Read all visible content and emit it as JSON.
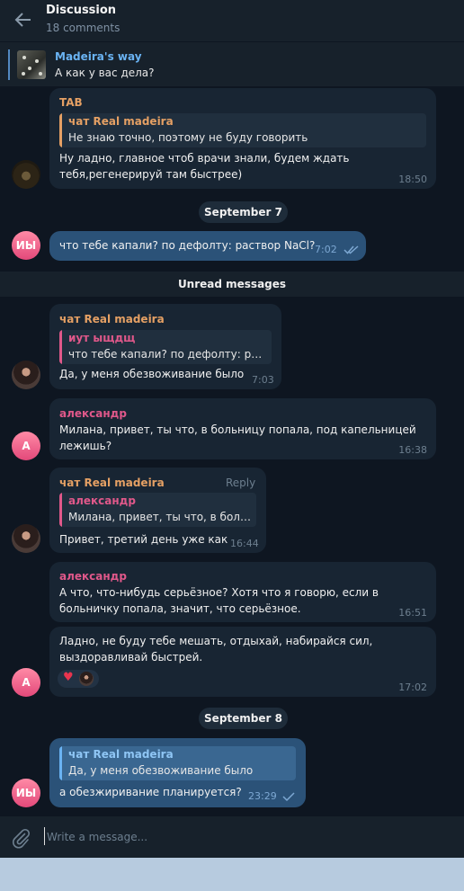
{
  "header": {
    "title": "Discussion",
    "subtitle": "18 comments"
  },
  "pinned": {
    "name": "Madeira's way",
    "text": "А как у вас дела?"
  },
  "messages": {
    "m1": {
      "sender": "TAB",
      "quote_name": "чат Real madeira",
      "quote_text": "Не знаю точно, поэтому не буду говорить",
      "line1": "Ну ладно, главное чтоб врачи знали, будем ждать",
      "line2": "тебя,регенерируй там быстрее)",
      "time": "18:50"
    },
    "m2": {
      "avatar": "ИЫ",
      "text": "что тебе капали? по дефолту: раствор NaCl?",
      "time": "7:02"
    },
    "m3": {
      "sender": "чат Real madeira",
      "quote_name": "иут ыщдщ",
      "quote_text": "что тебе капали? по дефолту: рас...",
      "text": "Да, у меня обезвоживание было",
      "time": "7:03"
    },
    "m4": {
      "avatar": "А",
      "sender": "александр",
      "line1": "Милана, привет, ты что, в больницу попала, под капельницей",
      "line2": "лежишь?",
      "time": "16:38"
    },
    "m5": {
      "sender": "чат Real madeira",
      "reply": "Reply",
      "quote_name": "александр",
      "quote_text": "Милана, привет, ты что, в боль...",
      "text": "Привет, третий день уже как",
      "time": "16:44"
    },
    "m6": {
      "sender": "александр",
      "line1": "А что, что-нибудь серьёзное? Хотя что я говорю, если в",
      "line2": "больничку попала, значит, что серьёзное.",
      "time": "16:51"
    },
    "m7": {
      "avatar": "А",
      "line1": "Ладно, не буду тебе мешать, отдыхай, набирайся сил,",
      "line2": "выздоравливай быстрей.",
      "reaction": "♥",
      "time": "17:02"
    },
    "m8": {
      "avatar": "ИЫ",
      "quote_name": "чат Real madeira",
      "quote_text": "Да, у меня обезвоживание было",
      "text": "а обезжиривание планируется?",
      "time": "23:29"
    }
  },
  "dates": {
    "d1": "September 7",
    "d2": "September 8"
  },
  "unread_label": "Unread messages",
  "composer": {
    "placeholder": "Write a message..."
  },
  "colors": {
    "bg": "#0e1621",
    "bubble_in": "#182533",
    "bubble_out": "#2b5278",
    "accent": "#6ab3f3",
    "orange": "#e5a064",
    "pink": "#e0588a"
  }
}
